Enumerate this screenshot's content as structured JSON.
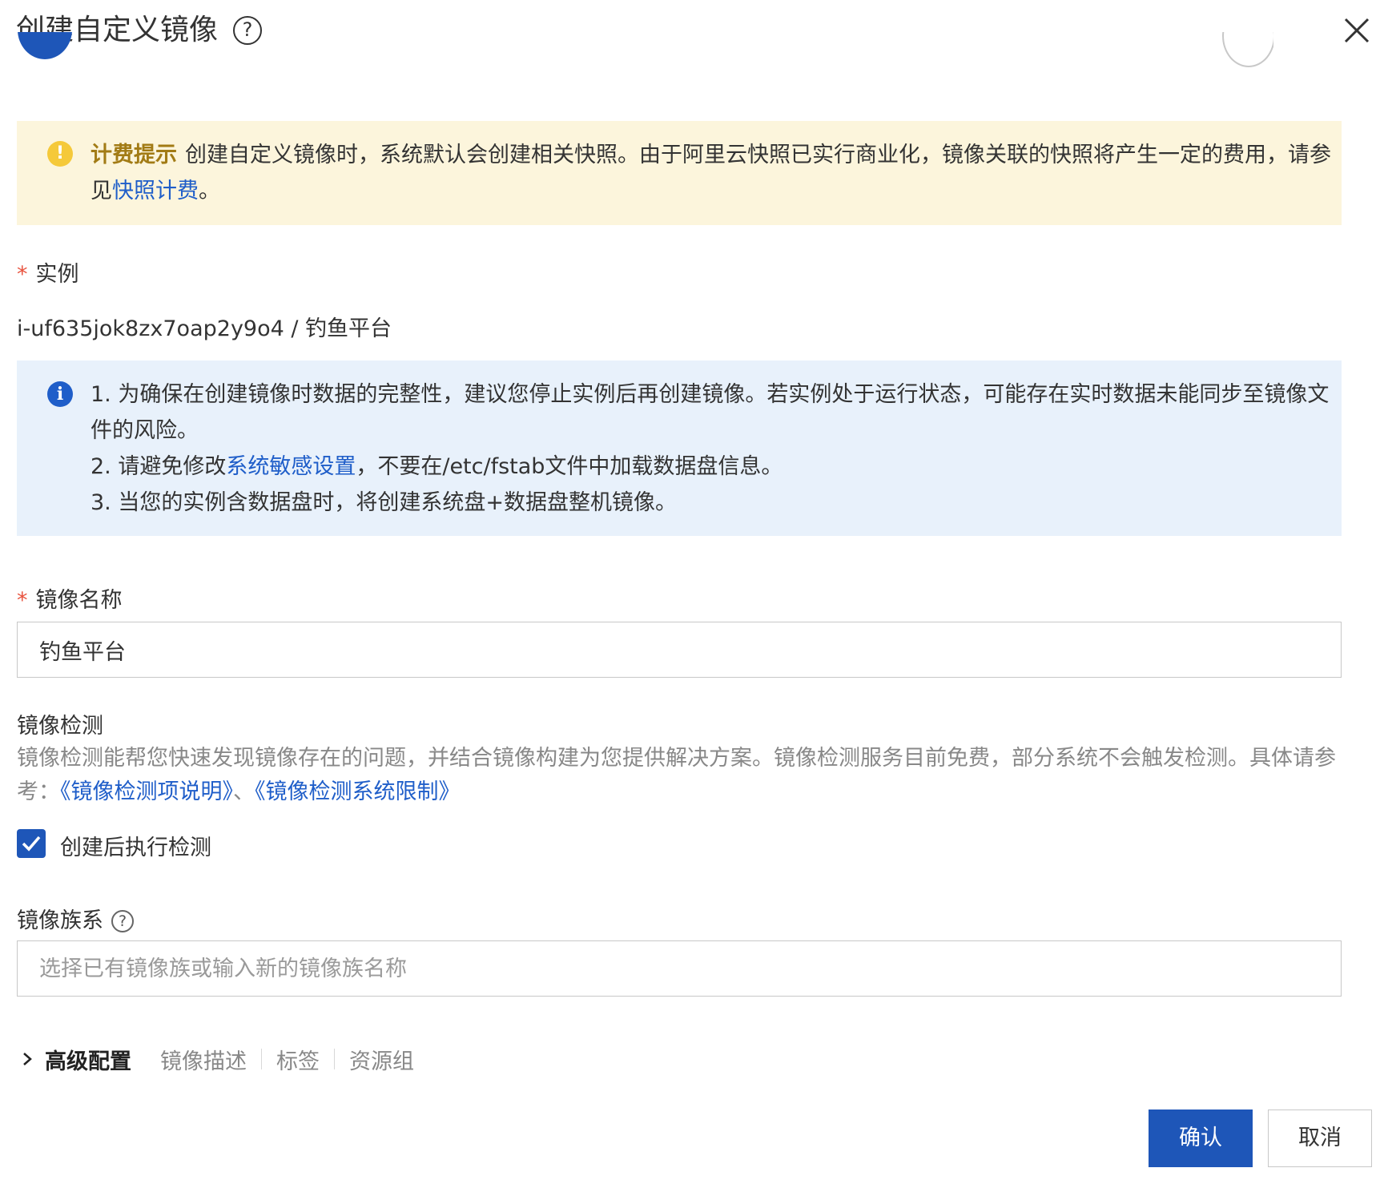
{
  "dialog": {
    "title": "创建自定义镜像",
    "help_glyph": "?",
    "close_icon": "close-icon"
  },
  "billing_notice": {
    "icon": "warning-icon",
    "icon_glyph": "!",
    "title": "计费提示",
    "text": "创建自定义镜像时，系统默认会创建相关快照。由于阿里云快照已实行商业化，镜像关联的快照将产生一定的费用，请参见",
    "link": "快照计费",
    "suffix": "。"
  },
  "instance": {
    "required_mark": "*",
    "label": "实例",
    "value": "i-uf635jok8zx7oap2y9o4 / 钓鱼平台"
  },
  "info_notice": {
    "icon": "info-icon",
    "icon_glyph": "i",
    "item1": "1. 为确保在创建镜像时数据的完整性，建议您停止实例后再创建镜像。若实例处于运行状态，可能存在实时数据未能同步至镜像文件的风险。",
    "item2_prefix": "2. 请避免修改",
    "item2_link": "系统敏感设置",
    "item2_suffix": "，不要在/etc/fstab文件中加载数据盘信息。",
    "item3": "3. 当您的实例含数据盘时，将创建系统盘+数据盘整机镜像。"
  },
  "image_name": {
    "required_mark": "*",
    "label": "镜像名称",
    "value": "钓鱼平台"
  },
  "image_check": {
    "label": "镜像检测",
    "description": "镜像检测能帮您快速发现镜像存在的问题，并结合镜像构建为您提供解决方案。镜像检测服务目前免费，部分系统不会触发检测。具体请参考：",
    "link1": "《镜像检测项说明》",
    "separator": "、",
    "link2": "《镜像检测系统限制》",
    "checkbox_label": "创建后执行检测",
    "checkbox_checked": true
  },
  "image_family": {
    "label": "镜像族系",
    "help_glyph": "?",
    "placeholder": "选择已有镜像族或输入新的镜像族名称"
  },
  "advanced": {
    "title": "高级配置",
    "items": [
      "镜像描述",
      "标签",
      "资源组"
    ]
  },
  "buttons": {
    "confirm": "确认",
    "cancel": "取消"
  },
  "colors": {
    "primary": "#1e56b8",
    "link": "#1f5ec9",
    "warning_bg": "#fcf5dc",
    "warning_icon": "#f5c93a",
    "info_bg": "#e8f1fb",
    "required": "#e8533f"
  }
}
